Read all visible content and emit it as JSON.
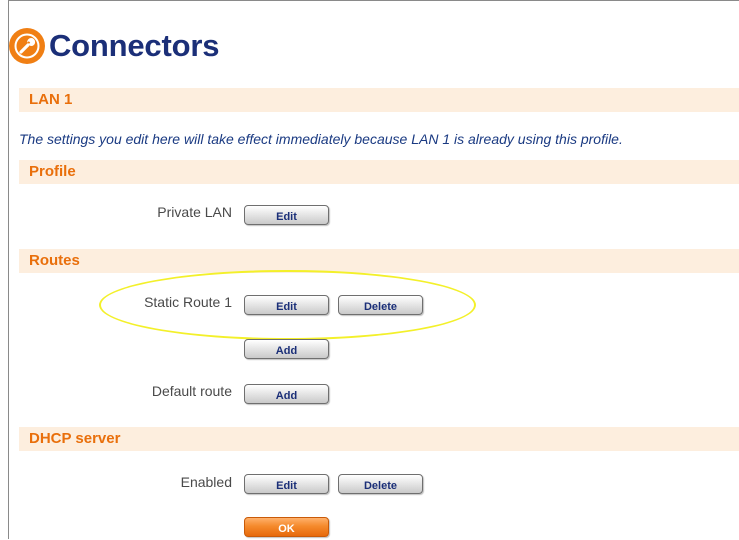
{
  "page": {
    "title": "Connectors",
    "icon": "wrench-icon"
  },
  "lan_section": {
    "heading": "LAN 1",
    "notice": "The settings you edit here will take effect immediately because LAN 1 is already using this profile."
  },
  "profile_section": {
    "heading": "Profile",
    "rows": [
      {
        "label": "Private LAN",
        "buttons": [
          "Edit"
        ]
      }
    ]
  },
  "routes_section": {
    "heading": "Routes",
    "static_route": {
      "label": "Static Route 1",
      "edit": "Edit",
      "delete": "Delete"
    },
    "add_route": "Add",
    "default_route": {
      "label": "Default route",
      "add": "Add"
    }
  },
  "dhcp_section": {
    "heading": "DHCP server",
    "enabled": {
      "label": "Enabled",
      "edit": "Edit",
      "delete": "Delete"
    },
    "ok": "OK"
  },
  "colors": {
    "accent_orange": "#f07f14",
    "title_navy": "#1b2f78",
    "section_bg": "#fdeede",
    "highlight": "#f3f02a"
  }
}
